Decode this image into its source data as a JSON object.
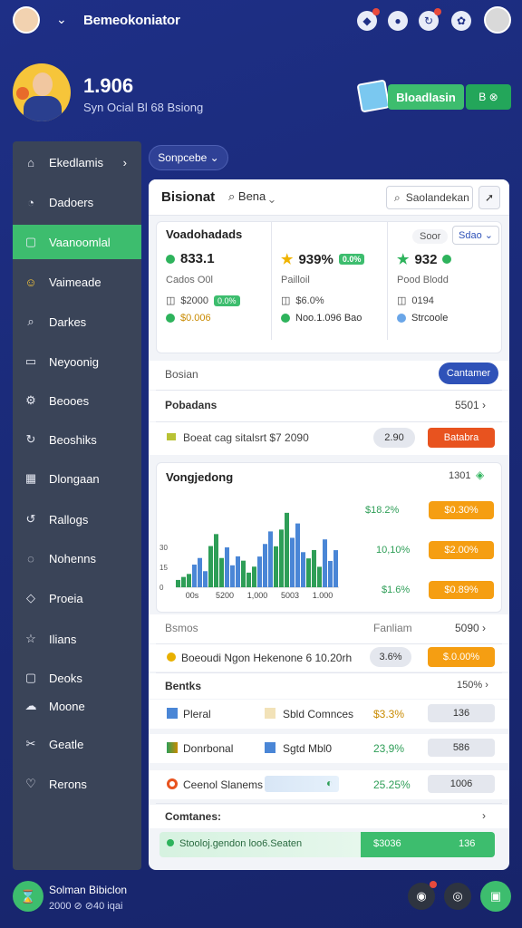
{
  "header": {
    "title": "Bemeokoniator",
    "chevron": "⌄"
  },
  "profile": {
    "value": "1.906",
    "subtitle": "Syn Ocial Bl 68 Bsiong"
  },
  "actions": {
    "primary_label": "Bloadlasin",
    "secondary_label": "B ⊗"
  },
  "filter": {
    "label": "Sonpcebe ⌄"
  },
  "sidebar": {
    "items": [
      {
        "label": "Ekedlamis",
        "icon": "home-icon",
        "glyph": "⌂"
      },
      {
        "label": "Dadoers",
        "icon": "clock-icon",
        "glyph": "◔"
      },
      {
        "label": "Vaanoomlal",
        "icon": "square-icon",
        "glyph": "▢"
      },
      {
        "label": "Vaimeade",
        "icon": "smile-icon",
        "glyph": "☺"
      },
      {
        "label": "Darkes",
        "icon": "search-icon",
        "glyph": "⌕"
      },
      {
        "label": "Neyoonig",
        "icon": "document-icon",
        "glyph": "▭"
      },
      {
        "label": "Beooes",
        "icon": "gear-icon",
        "glyph": "⚙"
      },
      {
        "label": "Beoshiks",
        "icon": "refresh-icon",
        "glyph": "↻"
      },
      {
        "label": "Dlongaan",
        "icon": "calendar-icon",
        "glyph": "▦"
      },
      {
        "label": "Rallogs",
        "icon": "reload-icon",
        "glyph": "↺"
      },
      {
        "label": "Nohenns",
        "icon": "chat-icon",
        "glyph": "◌"
      },
      {
        "label": "Proeia",
        "icon": "tag-icon",
        "glyph": "◇"
      },
      {
        "label": "Ilians",
        "icon": "star-icon",
        "glyph": "☆"
      },
      {
        "label": "Deoks",
        "icon": "box-icon",
        "glyph": "▢"
      },
      {
        "label": "Moone",
        "icon": "cloud-icon",
        "glyph": "☁"
      },
      {
        "label": "Geatle",
        "icon": "scissors-icon",
        "glyph": "✂"
      },
      {
        "label": "Rerons",
        "icon": "heart-icon",
        "glyph": "♡"
      }
    ]
  },
  "footer_left": {
    "title": "Solman Bibiclon",
    "subtitle": "2000 ⊘ ⊘40 iqai"
  },
  "panel": {
    "title": "Bisionat",
    "search_label": "Bena ⌄",
    "search_placeholder": "Saolandekan",
    "overview": {
      "title": "Voadohadads",
      "select1": "Soor",
      "select2": "Sdao ⌄",
      "stats": [
        {
          "value": "833.1",
          "label": "Cados O0l",
          "line2": "$2000",
          "chip": "0.0%",
          "line3": "$0.006"
        },
        {
          "value": "939%",
          "label": "Pailloil",
          "line2": "$6.0%",
          "chip": "0.0%",
          "line3": "Noo.1.096 Bao"
        },
        {
          "value": "932",
          "label": "Pood Blodd",
          "line2": "0194",
          "chip": "",
          "line3": "Strcoole"
        }
      ]
    },
    "section1": {
      "label": "Bosian",
      "button": "Cantamer"
    },
    "section2": {
      "label": "Pobadans",
      "right": "5501 ›"
    },
    "section3": {
      "label": "Boeat cag sitalsrt $7 2090",
      "pill": "2.90",
      "badge": "Batabra"
    },
    "chart": {
      "title": "Vongjedong",
      "right": "1301",
      "legend": [
        {
          "value": "$18.2%",
          "badge": "$0.30%"
        },
        {
          "value": "10,10%",
          "badge": "$2.00%"
        },
        {
          "value": "$1.6%",
          "badge": "$0.89%"
        }
      ]
    },
    "section4": {
      "label": "Bsmos",
      "mid": "Fanliam",
      "right": "5090 ›"
    },
    "section5": {
      "label": "Boeoudi Ngon Hekenone 6 10.20rh",
      "pill": "3.6%",
      "badge": "$.0.00%"
    },
    "details": {
      "title": "Bentks",
      "right": "150% ›",
      "rows": [
        {
          "icon": "chart-icon",
          "name": "Pleral",
          "tag": "Sbld Comnces",
          "pct": "$3.3%",
          "val": "136"
        },
        {
          "icon": "bar-chart-icon",
          "name": "Donrbonal",
          "tag": "Sgtd Mbl0",
          "pct": "23,9%",
          "val": "586"
        },
        {
          "icon": "target-icon",
          "name": "Ceenol Slanems",
          "tag": "",
          "pct": "25.25%",
          "val": "1006"
        }
      ]
    },
    "comments": {
      "label": "Comtanes:",
      "footer_text": "Stooloj.gendon loo6.Seaten",
      "footer_value": "$3036",
      "footer_right": "136"
    }
  },
  "chart_data": {
    "type": "bar",
    "categories": [
      "00s",
      "5200",
      "1,000",
      "5003",
      "1.000"
    ],
    "series": [
      {
        "name": "",
        "values": [
          10,
          40,
          20,
          56,
          28
        ]
      },
      {
        "name": "",
        "values": [
          22,
          30,
          42,
          48,
          36
        ]
      }
    ],
    "ylim": [
      0,
      60
    ],
    "ytick_labels": [
      "0",
      "15",
      "30"
    ],
    "colors": [
      "#2e9e57",
      "#4a86d6"
    ],
    "title": "Vongjedong",
    "xlabel": "",
    "ylabel": ""
  }
}
